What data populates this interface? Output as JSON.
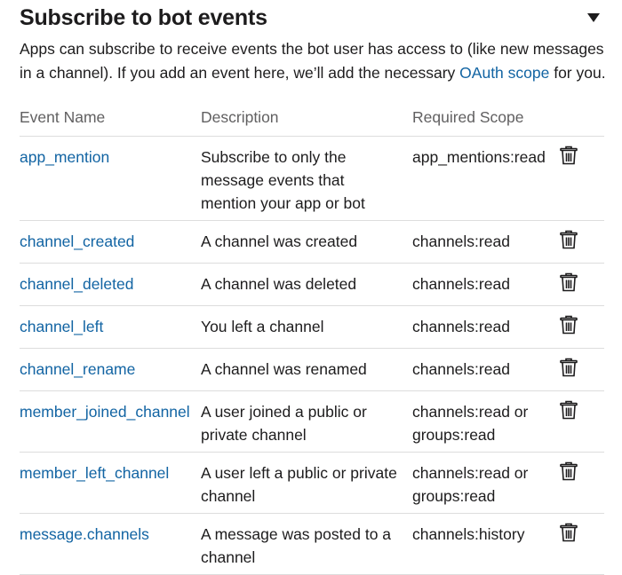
{
  "section": {
    "title": "Subscribe to bot events",
    "description_prefix": "Apps can subscribe to receive events the bot user has access to (like new messages in a channel). If you add an event here, we’ll add the necessary ",
    "description_link": "OAuth scope",
    "description_suffix": " for you."
  },
  "table": {
    "headers": [
      "Event Name",
      "Description",
      "Required Scope"
    ],
    "rows": [
      {
        "event": "app_mention",
        "description": "Subscribe to only the message events that mention your app or bot",
        "scope": "app_mentions:read"
      },
      {
        "event": "channel_created",
        "description": "A channel was created",
        "scope": "channels:read"
      },
      {
        "event": "channel_deleted",
        "description": "A channel was deleted",
        "scope": "channels:read"
      },
      {
        "event": "channel_left",
        "description": "You left a channel",
        "scope": "channels:read"
      },
      {
        "event": "channel_rename",
        "description": "A channel was renamed",
        "scope": "channels:read"
      },
      {
        "event": "member_joined_channel",
        "description": "A user joined a public or private channel",
        "scope": "channels:read or groups:read"
      },
      {
        "event": "member_left_channel",
        "description": "A user left a public or private channel",
        "scope": "channels:read or groups:read"
      },
      {
        "event": "message.channels",
        "description": "A message was posted to a channel",
        "scope": "channels:history"
      }
    ]
  },
  "icons": {
    "toggle": "caret-down-icon",
    "row_action": "trash-icon"
  },
  "colors": {
    "link": "#1264a3",
    "text": "#1d1c1d",
    "header_text": "#616061",
    "divider": "#dddddd"
  }
}
